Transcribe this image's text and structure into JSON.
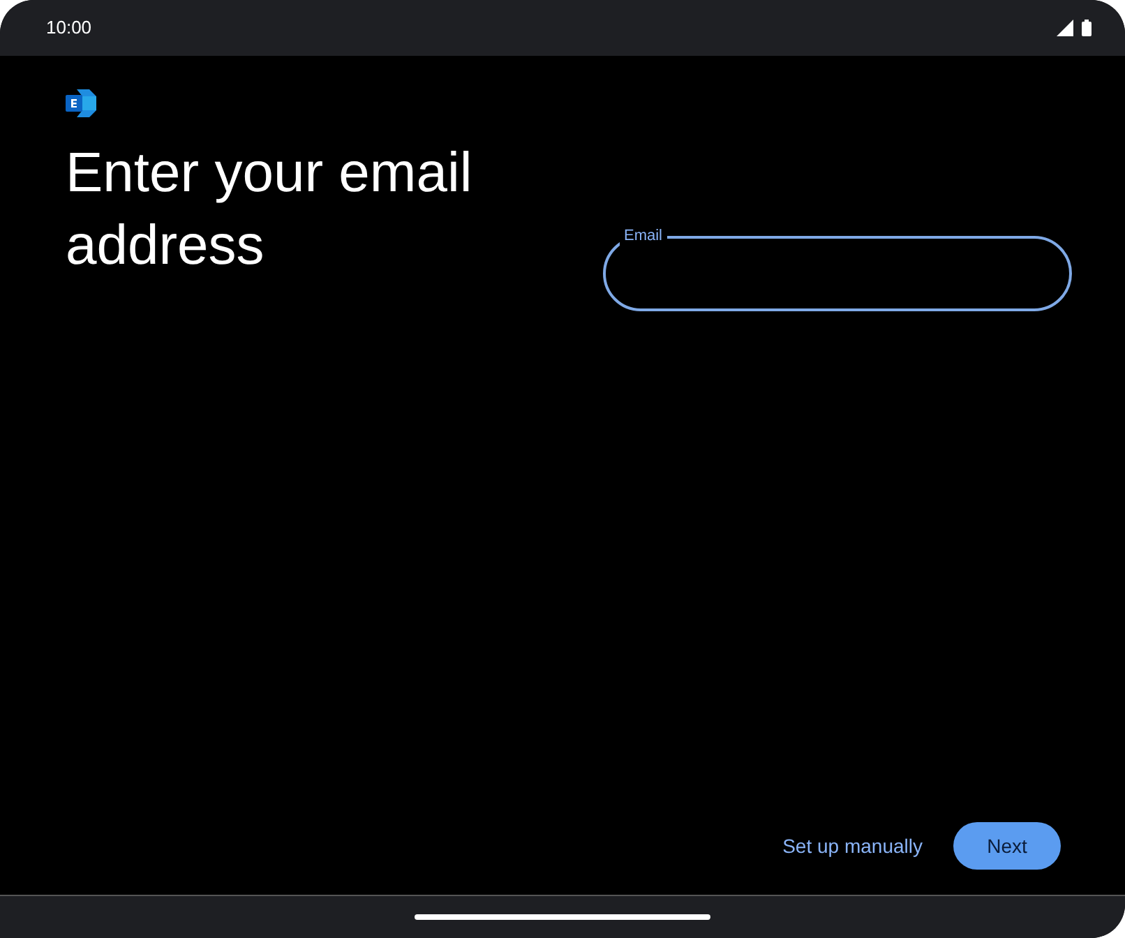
{
  "status_bar": {
    "time": "10:00"
  },
  "title": "Enter your email address",
  "email_field": {
    "label": "Email",
    "focused": true
  },
  "actions": [
    {
      "kind": "text",
      "label": "Set up manually"
    },
    {
      "kind": "filled",
      "label": "Next"
    }
  ]
}
